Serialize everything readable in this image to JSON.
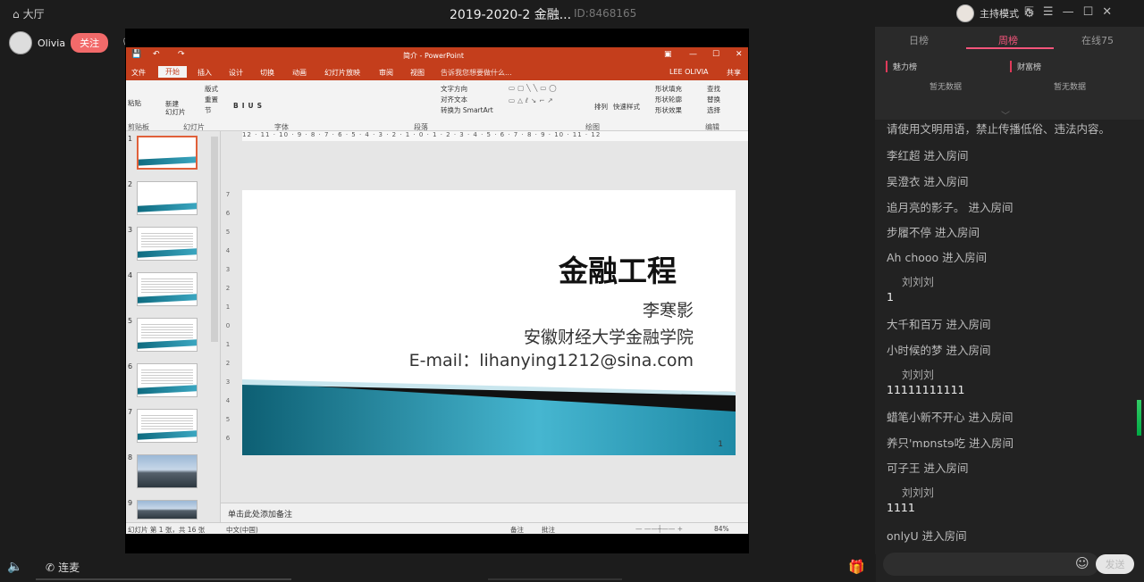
{
  "topbar": {
    "hall_label": "大厅",
    "title": "2019-2020-2 金融...",
    "room_id": "ID:8468165",
    "host_mode_label": "主持模式"
  },
  "host": {
    "name": "Olivia",
    "follow_label": "关注",
    "queue_label": "排麦"
  },
  "ppt": {
    "window_title": "简介 - PowerPoint",
    "tabs": [
      "文件",
      "开始",
      "插入",
      "设计",
      "切换",
      "动画",
      "幻灯片放映",
      "审阅",
      "视图"
    ],
    "tell_me": "告诉我您想要做什么...",
    "user": "LEE OLIVIA",
    "share": "共享",
    "ribbon_groups": [
      "剪贴板",
      "幻灯片",
      "字体",
      "段落",
      "绘图",
      "编辑"
    ],
    "ribbon_items": {
      "paste": "粘贴",
      "new_slide": "新建\n幻灯片",
      "layout": "版式",
      "reset": "重置",
      "section": "节",
      "text_dir": "文字方向",
      "align_text": "对齐文本",
      "smartart": "转换为 SmartArt",
      "arrange": "排列",
      "quick_styles": "快速样式",
      "fill": "形状填充",
      "outline": "形状轮廓",
      "effects": "形状效果",
      "find": "查找",
      "replace": "替换",
      "select": "选择"
    },
    "ruler_text": "12 · 11 · 10 · 9 · 8 · 7 · 6 · 5 · 4 · 3 · 2 · 1 · 0 · 1 · 2 · 3 · 4 · 5 · 6 · 7 · 8 · 9 · 10 · 11 · 12",
    "thumb_numbers": [
      "1",
      "2",
      "3",
      "4",
      "5",
      "6",
      "7",
      "8",
      "9"
    ],
    "slide": {
      "title": "金融工程",
      "author": "李寒影",
      "school": "安徽财经大学金融学院",
      "email": "E-mail：lihanying1212@sina.com",
      "number": "1"
    },
    "notes_placeholder": "单击此处添加备注",
    "status": {
      "slide_count": "幻灯片 第 1 张，共 16 张",
      "language": "中文(中国)",
      "notes": "备注",
      "comments": "批注",
      "zoom": "84%"
    }
  },
  "panel": {
    "tabs": [
      "日榜",
      "周榜",
      "在线75"
    ],
    "charm_label": "魅力榜",
    "wealth_label": "财富榜",
    "empty_label": "暂无数据",
    "chat": [
      {
        "text": "请使用文明用语，禁止传播低俗、违法内容。"
      },
      {
        "text": "李红超 进入房间"
      },
      {
        "text": "吴澄衣 进入房间"
      },
      {
        "text": "追月亮的影子。 进入房间"
      },
      {
        "text": "步履不停 进入房间"
      },
      {
        "text": "Ah chooo 进入房间"
      },
      {
        "name": "刘刘刘",
        "text": "1"
      },
      {
        "text": "大千和百万 进入房间"
      },
      {
        "text": "小时候的梦 进入房间"
      },
      {
        "name": "刘刘刘",
        "text": "11111111111"
      },
      {
        "text": "蜡笔小新不开心 进入房间"
      },
      {
        "text": "养只'mɒnstɘ吃     进入房间"
      },
      {
        "text": "可子王 进入房间"
      },
      {
        "name": "刘刘刘",
        "text": "1111"
      },
      {
        "text": "onlyU 进入房间"
      }
    ],
    "send_label": "发送"
  },
  "bottom": {
    "lianmai_label": "连麦"
  }
}
